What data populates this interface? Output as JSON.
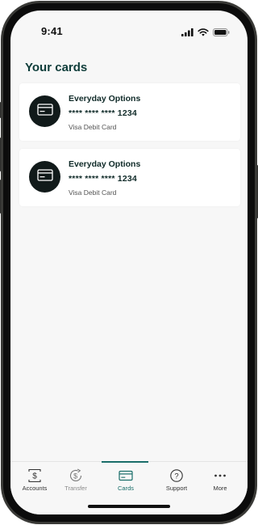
{
  "status_bar": {
    "time": "9:41",
    "icons": [
      "signal-icon",
      "wifi-icon",
      "battery-icon"
    ]
  },
  "page": {
    "title": "Your cards"
  },
  "cards": [
    {
      "name": "Everyday Options",
      "number": "**** **** **** 1234",
      "type": "Visa Debit Card",
      "icon": "credit-card-icon"
    },
    {
      "name": "Everyday Options",
      "number": "**** **** **** 1234",
      "type": "Visa Debit Card",
      "icon": "credit-card-icon"
    }
  ],
  "tab_bar": {
    "tabs": [
      {
        "label": "Accounts",
        "icon": "dollar-doc-icon",
        "state": "normal"
      },
      {
        "label": "Transfer",
        "icon": "transfer-icon",
        "state": "disabled"
      },
      {
        "label": "Cards",
        "icon": "card-icon",
        "state": "active"
      },
      {
        "label": "Support",
        "icon": "help-icon",
        "state": "normal"
      },
      {
        "label": "More",
        "icon": "more-dots-icon",
        "state": "normal"
      }
    ]
  },
  "colors": {
    "accent": "#1a6e6a",
    "title": "#0f3d3a",
    "background": "#f7f7f7",
    "avatar": "#111a1a"
  }
}
